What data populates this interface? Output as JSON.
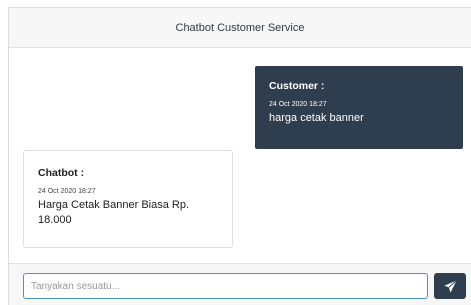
{
  "header": {
    "title": "Chatbot Customer Service"
  },
  "messages": [
    {
      "sender": "Customer :",
      "timestamp": "24 Oct 2020 18:27",
      "text": "harga cetak banner"
    },
    {
      "sender": "Chatbot :",
      "timestamp": "24 Oct 2020 18:27",
      "text": "Harga Cetak Banner Biasa Rp. 18.000"
    }
  ],
  "footer": {
    "input_placeholder": "Tanyakan sesuatu...",
    "input_value": "",
    "send_icon": "paper-plane-icon"
  },
  "colors": {
    "customer_bubble": "#2f3e4e",
    "send_button": "#2f3e4e",
    "input_focus_border": "#4a90d9"
  }
}
